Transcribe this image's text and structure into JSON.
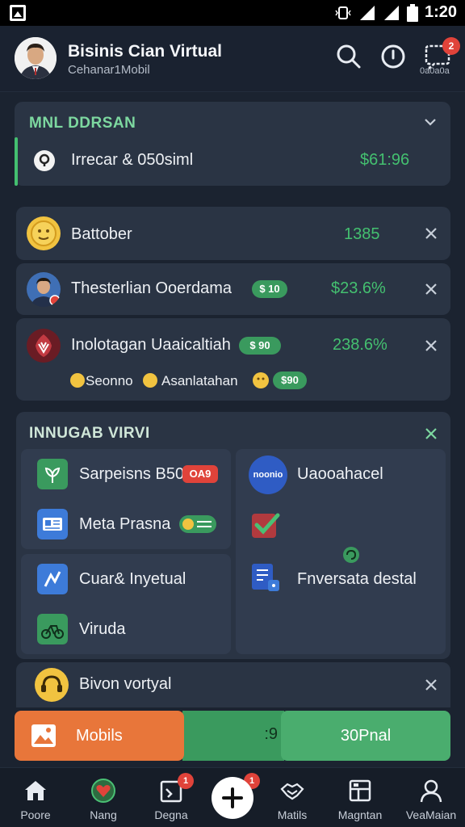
{
  "status_bar": {
    "time": "1:20"
  },
  "header": {
    "title": "Bisinis Cian Virtual",
    "subtitle": "Cehanar1Mobil",
    "notification_badge": "2",
    "icon_label": "0a0a0a",
    "icons": [
      "search-icon",
      "compass-icon",
      "chat-icon"
    ]
  },
  "summary": {
    "title": "MNL DDRSAN",
    "row_label": "Irrecar & 050siml",
    "row_value": "$61:96"
  },
  "list": [
    {
      "label": "Battober",
      "value": "1385"
    },
    {
      "label": "Thesterlian Ooerdama",
      "pill": "$ 10",
      "value": "$23.6%"
    },
    {
      "label": "Inolotagan Uaaicaltiah",
      "pill": "$ 90",
      "value": "238.6%",
      "sub_left": "Seonno",
      "sub_right": "Asanlatahan",
      "sub_pill": "$90"
    }
  ],
  "section": {
    "title": "INNUGAB VIRVI",
    "tiles_left_top": [
      {
        "label": "Sarpeisns B50",
        "pill": "OA9"
      },
      {
        "label": "Meta Prasna",
        "pill": ""
      }
    ],
    "tiles_left_bottom": [
      {
        "label": "Cuar& Inyetual"
      },
      {
        "label": "Viruda"
      }
    ],
    "tiles_right": [
      {
        "label": "Uaooahacel",
        "icon_text": "noonio"
      },
      {
        "label": ""
      },
      {
        "label": "Fnversata destal"
      }
    ]
  },
  "bottom_card": {
    "label": "Bivon vortyal"
  },
  "action_bar": {
    "left_label": "Mobils",
    "mid_label": ":9",
    "right_label": "30Pnal"
  },
  "bottom_nav": [
    {
      "label": "Poore",
      "badge": ""
    },
    {
      "label": "Nang",
      "badge": ""
    },
    {
      "label": "Degna",
      "badge": "1"
    },
    {
      "label": "",
      "badge": "1"
    },
    {
      "label": "Matils",
      "badge": ""
    },
    {
      "label": "Magntan",
      "badge": ""
    },
    {
      "label": "VeaMaian",
      "badge": ""
    }
  ],
  "colors": {
    "accent_green": "#44c070",
    "accent_orange": "#e8763a",
    "badge_red": "#e0433a",
    "card": "#2a3444",
    "background": "#1b2330"
  }
}
